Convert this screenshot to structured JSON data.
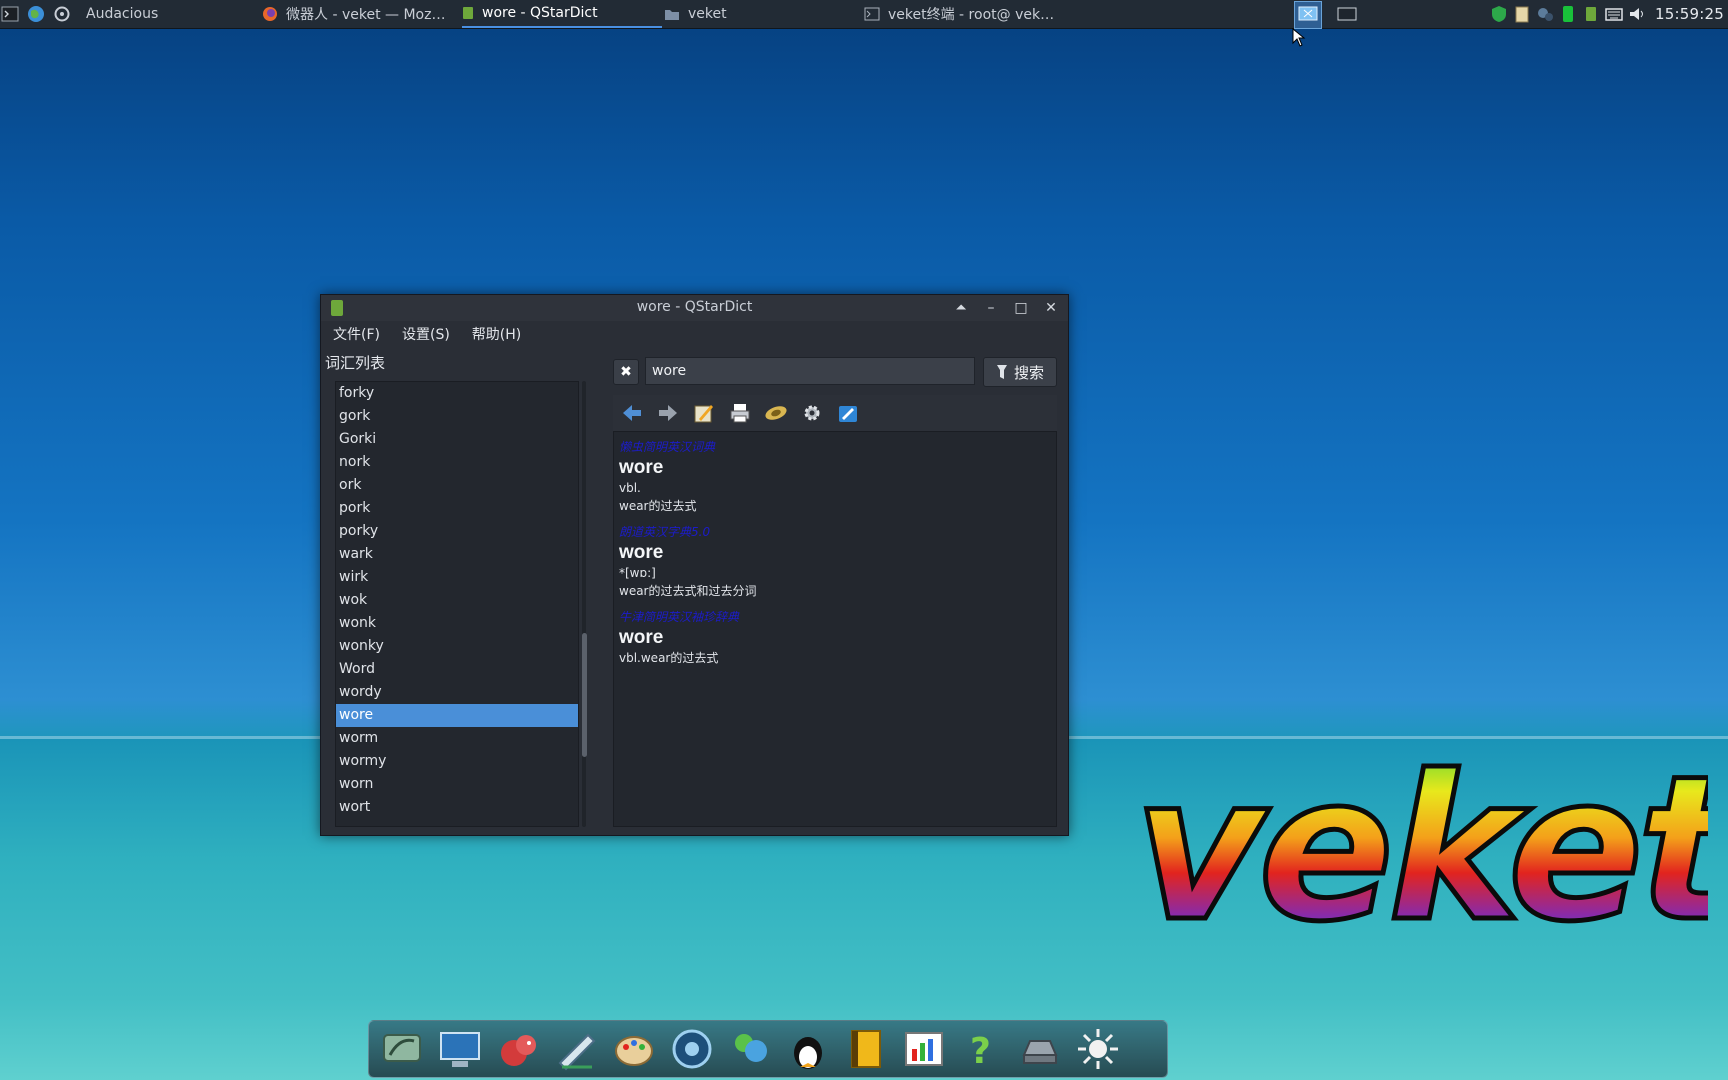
{
  "taskbar": {
    "tasks": [
      {
        "label": "Audacious",
        "icon": "audacious-icon"
      },
      {
        "label": "微器人 - veket — Moz…",
        "icon": "firefox-icon"
      },
      {
        "label": "wore - QStarDict",
        "icon": "qstardict-icon",
        "active": true
      },
      {
        "label": "veket",
        "icon": "folder-icon"
      },
      {
        "label": "veket终端 - root@ vek…",
        "icon": "terminal-icon"
      }
    ],
    "clock": "15:59:25"
  },
  "window": {
    "title": "wore - QStarDict",
    "menu": [
      "文件(F)",
      "设置(S)",
      "帮助(H)"
    ],
    "word_list_title": "词汇列表",
    "word_list": [
      "forky",
      "gork",
      "Gorki",
      "nork",
      "ork",
      "pork",
      "porky",
      "wark",
      "wirk",
      "wok",
      "wonk",
      "wonky",
      "Word",
      "wordy",
      "wore",
      "worm",
      "wormy",
      "worn",
      "wort"
    ],
    "selected_word": "wore",
    "search": {
      "value": "wore",
      "button_label": "搜索"
    },
    "toolbar_icons": [
      "back-arrow-icon",
      "forward-arrow-icon",
      "edit-icon",
      "print-icon",
      "speak-icon",
      "plugins-icon",
      "settings-icon"
    ],
    "entries": [
      {
        "dict": "懒虫简明英汉词典",
        "word": "wore",
        "lines": [
          "vbl.",
          "wear的过去式"
        ]
      },
      {
        "dict": "朗道英汉字典5.0",
        "word": "wore",
        "lines": [
          "*[wɒ:]",
          "wear的过去式和过去分词"
        ]
      },
      {
        "dict": "牛津简明英汉袖珍辞典",
        "word": "wore",
        "lines": [
          "vbl.wear的过去式"
        ]
      }
    ]
  },
  "desktop": {
    "logo_text": "veket"
  },
  "dock": {
    "apps": [
      "system-tools-icon",
      "monitor-icon",
      "squirrel-icon",
      "editor-icon",
      "paint-icon",
      "media-player-icon",
      "chat-icon",
      "qq-penguin-icon",
      "notebook-icon",
      "chart-icon",
      "help-icon",
      "drive-icon",
      "brightness-icon"
    ]
  },
  "colors": {
    "accent": "#4a8fd8",
    "dict_link": "#1c1cc9"
  }
}
